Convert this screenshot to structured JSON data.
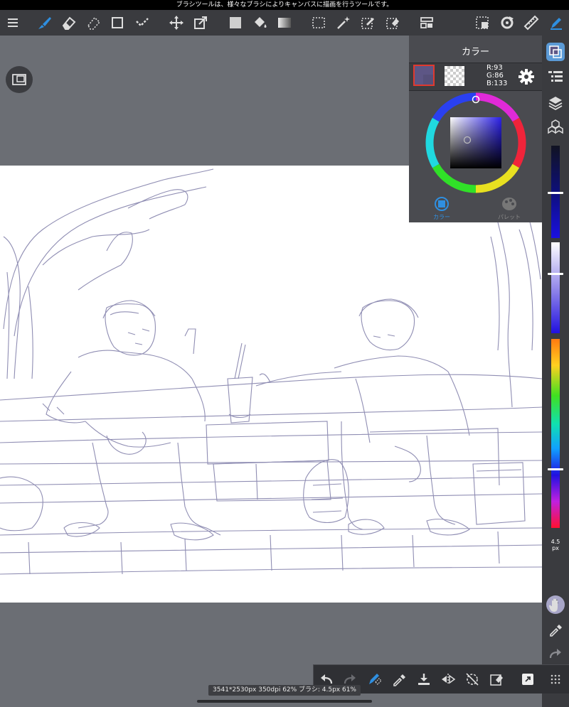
{
  "tip": "ブラシツールは、様々なブラシによりキャンバスに描画を行うツールです。",
  "toolbar": {
    "items": [
      "menu-icon",
      "brush-icon",
      "eraser-icon",
      "dotted-eraser-icon",
      "rectangle-icon",
      "correction-icon",
      "move-icon",
      "transform-icon",
      "fill-color-icon",
      "bucket-icon",
      "gradient-icon",
      "select-rect-icon",
      "magic-wand-icon",
      "select-pen-icon",
      "select-eraser-icon",
      "layout-icon",
      "select-all-icon",
      "rotate-icon",
      "ruler-icon",
      "pen-icon"
    ]
  },
  "color_panel": {
    "title": "カラー",
    "rgb_r": "R:93",
    "rgb_g": "G:86",
    "rgb_b": "B:133",
    "current_color": "#5d5685",
    "tab_color": "カラー",
    "tab_palette": "パレット"
  },
  "brush": {
    "size_value": "4.5",
    "size_unit": "px",
    "opacity_value": "61",
    "opacity_unit": "%"
  },
  "sliders": {
    "brightness_level": 0.55,
    "saturation_level": 0.34,
    "hue_level": 0.68
  },
  "status": "3541*2530px 350dpi 62% ブラシ: 4.5px 61%",
  "colors": {
    "accent": "#2f8fe0",
    "panel": "#3a3b3f",
    "canvas_bg": "#6b6e74"
  }
}
